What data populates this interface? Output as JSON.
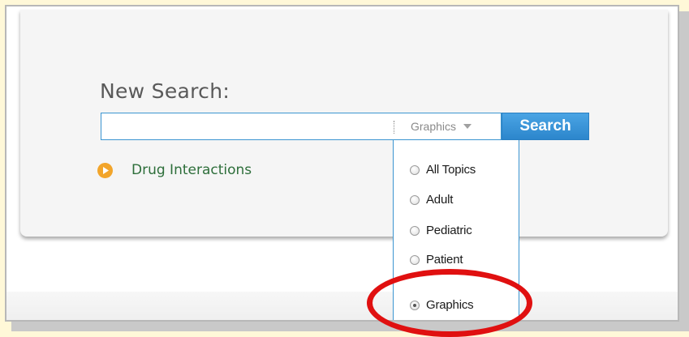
{
  "search": {
    "title": "New Search:",
    "input_value": "",
    "input_placeholder": "",
    "scope_selected": "Graphics",
    "button_label": "Search"
  },
  "links": {
    "drug_interactions": "Drug Interactions"
  },
  "scope_options": [
    {
      "label": "All Topics",
      "selected": false
    },
    {
      "label": "Adult",
      "selected": false
    },
    {
      "label": "Pediatric",
      "selected": false
    },
    {
      "label": "Patient",
      "selected": false
    },
    {
      "label": "Graphics",
      "selected": true
    }
  ],
  "colors": {
    "accent_blue": "#3b95d1",
    "search_button": "#2c86cc",
    "link_green": "#2d6e3a",
    "play_icon_orange": "#f2a52b",
    "highlight_red": "#e01010"
  },
  "icons": {
    "link_icon": "play-circle-icon",
    "dropdown_icon": "caret-down-icon"
  }
}
